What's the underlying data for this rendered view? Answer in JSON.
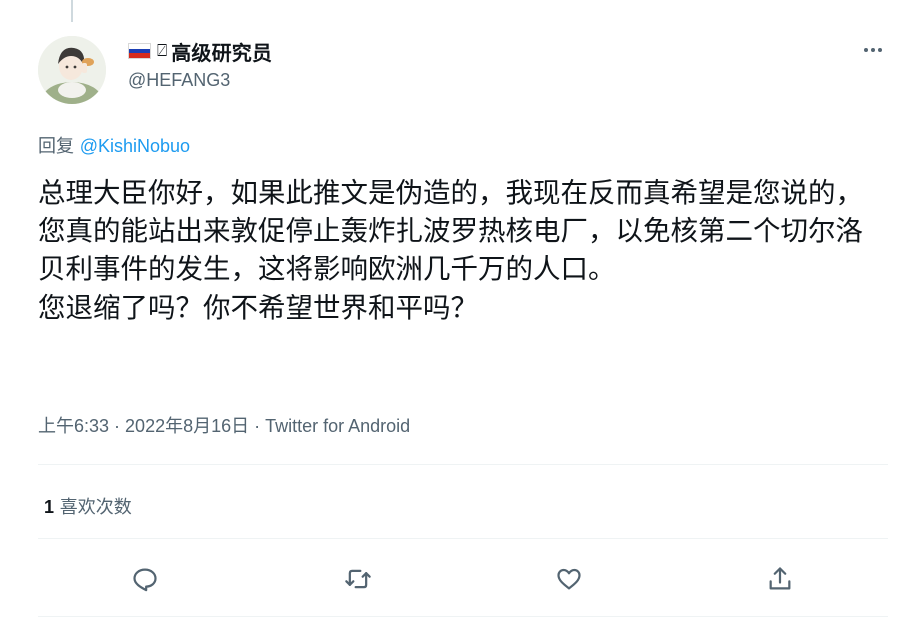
{
  "author": {
    "flag": "russia-flag",
    "icon_box": "⍁",
    "display_name": "高级研究员",
    "handle": "@HEFANG3"
  },
  "reply": {
    "prefix": "回复 ",
    "mention": "@KishiNobuo"
  },
  "tweet": {
    "text": "总理大臣你好，如果此推文是伪造的，我现在反而真希望是您说的，您真的能站出来敦促停止轰炸扎波罗热核电厂，以免核第二个切尔洛贝利事件的发生，这将影响欧洲几千万的人口。\n您退缩了吗？你不希望世界和平吗？"
  },
  "meta": {
    "time": "上午6:33",
    "sep1": " · ",
    "date": "2022年8月16日",
    "sep2": " · ",
    "source": "Twitter for Android"
  },
  "stats": {
    "likes_count": "1",
    "likes_label": " 喜欢次数"
  },
  "actions": {
    "reply": "reply-icon",
    "retweet": "retweet-icon",
    "like": "heart-icon",
    "share": "share-icon"
  },
  "colors": {
    "link": "#1d9bf0",
    "secondary_text": "#536471",
    "primary_text": "#0f1419",
    "divider": "#eff3f4"
  }
}
